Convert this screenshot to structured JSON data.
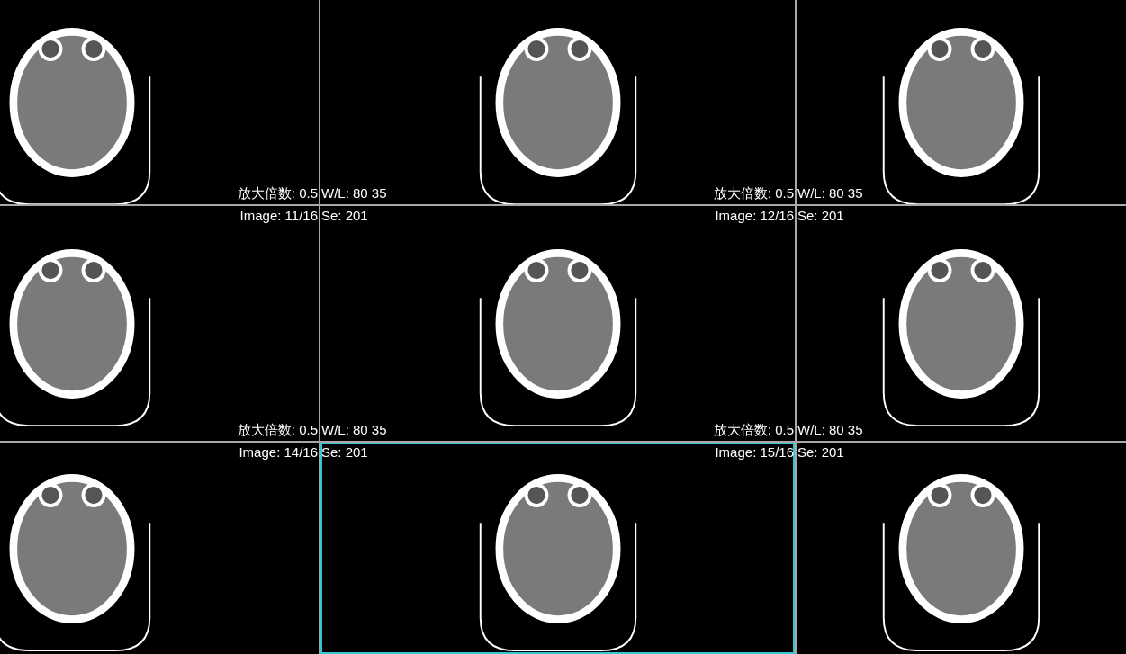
{
  "cells": [
    {
      "selected": false,
      "bottom_right": "放大倍数: 0.5"
    },
    {
      "selected": false,
      "bottom_left": "W/L: 80 35",
      "bottom_right": "放大倍数: 0.5"
    },
    {
      "selected": false,
      "bottom_left": "W/L: 80 35"
    },
    {
      "selected": false,
      "top_right": "Image: 11/16",
      "bottom_right": "放大倍数: 0.5"
    },
    {
      "selected": false,
      "top_left": "Se: 201",
      "top_right": "Image: 12/16",
      "bottom_left": "W/L: 80 35",
      "bottom_right": "放大倍数: 0.5"
    },
    {
      "selected": false,
      "top_left": "Se: 201",
      "bottom_left": "W/L: 80 35"
    },
    {
      "selected": false,
      "top_right": "Image: 14/16"
    },
    {
      "selected": true,
      "top_left": "Se: 201",
      "top_right": "Image: 15/16"
    },
    {
      "selected": false,
      "top_left": "Se: 201"
    }
  ]
}
